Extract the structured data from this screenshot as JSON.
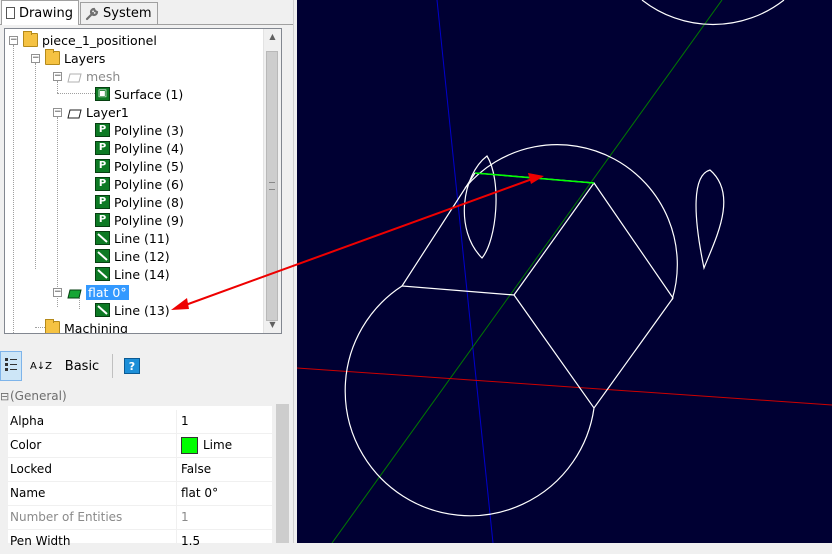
{
  "tabs": [
    {
      "label": "Drawing",
      "icon": "document-icon",
      "active": true
    },
    {
      "label": "System",
      "icon": "wrench-icon",
      "active": false
    }
  ],
  "tree": {
    "root": "piece_1_positionel",
    "layers_label": "Layers",
    "mesh_label": "mesh",
    "surface_label": "Surface (1)",
    "layer1_label": "Layer1",
    "layer1_items": [
      "Polyline (3)",
      "Polyline (4)",
      "Polyline (5)",
      "Polyline (6)",
      "Polyline (8)",
      "Polyline (9)",
      "Line (11)",
      "Line (12)",
      "Line (14)"
    ],
    "flat_label": "flat 0°",
    "flat_item": "Line (13)",
    "machining_label": "Machining",
    "icon_letter_polyline": "P"
  },
  "toolbar": {
    "categorized_icon": "categorized-icon",
    "alphabetical_icon": "sort-alpha-icon",
    "alpha_glyph": "A↓Z",
    "basic_label": "Basic",
    "help_icon": "help-icon",
    "help_glyph": "?"
  },
  "properties": {
    "category": "(General)",
    "collapse_glyph": "⊟",
    "rows": [
      {
        "name": "Alpha",
        "value": "1"
      },
      {
        "name": "Color",
        "value": "Lime",
        "swatch": "#00ff00"
      },
      {
        "name": "Locked",
        "value": "False"
      },
      {
        "name": "Name",
        "value": "flat 0°"
      },
      {
        "name": "Number of Entities",
        "value": "1",
        "disabled": true
      },
      {
        "name": "Pen Width",
        "value": "1.5"
      }
    ]
  },
  "viewport": {
    "background": "#000033",
    "axis_x_color": "#cc0000",
    "axis_y_color": "#0000cc",
    "axis_z_color": "#007a00",
    "geometry_color": "#ffffff",
    "selected_line_color": "#00ff00",
    "annotation_arrow_color": "#ee0000"
  }
}
